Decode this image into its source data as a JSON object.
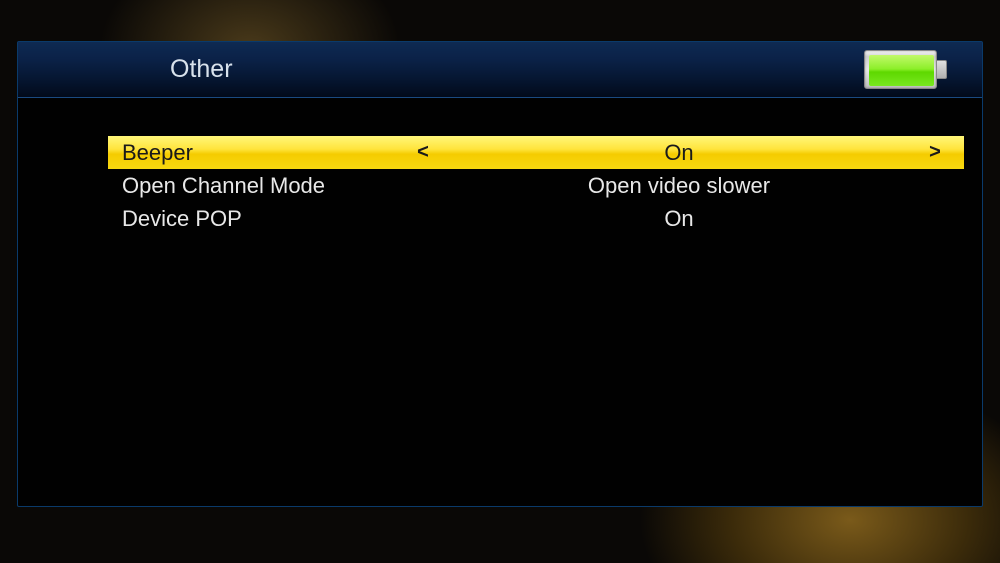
{
  "header": {
    "title": "Other"
  },
  "settings": [
    {
      "label": "Beeper",
      "value": "On",
      "selected": true
    },
    {
      "label": "Open Channel Mode",
      "value": "Open video slower",
      "selected": false
    },
    {
      "label": "Device POP",
      "value": "On",
      "selected": false
    }
  ],
  "glyphs": {
    "chevron_left": "<",
    "chevron_right": ">"
  }
}
